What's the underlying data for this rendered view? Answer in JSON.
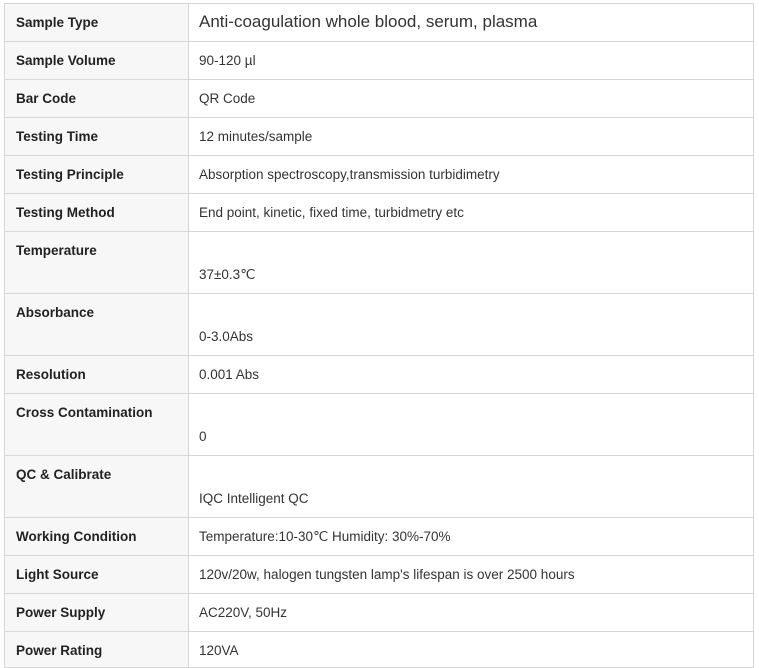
{
  "spec_table": {
    "rows": [
      {
        "label": "Sample Type",
        "value": "Anti-coagulation whole blood, serum, plasma"
      },
      {
        "label": "Sample Volume",
        "value": "90-120 µl"
      },
      {
        "label": "Bar Code",
        "value": "QR Code"
      },
      {
        "label": "Testing Time",
        "value": "12 minutes/sample"
      },
      {
        "label": "Testing Principle",
        "value": "Absorption spectroscopy,transmission turbidimetry"
      },
      {
        "label": "Testing Method",
        "value": "End point, kinetic, fixed time, turbidmetry etc"
      },
      {
        "label": "Temperature",
        "value": "37±0.3℃"
      },
      {
        "label": "Absorbance",
        "value": "0-3.0Abs"
      },
      {
        "label": "Resolution",
        "value": "0.001 Abs"
      },
      {
        "label": "Cross Contamination",
        "value": "0"
      },
      {
        "label": "QC & Calibrate",
        "value": "IQC Intelligent QC"
      },
      {
        "label": "Working Condition",
        "value": "Temperature:10-30℃ Humidity: 30%-70%"
      },
      {
        "label": "Light Source",
        "value": "120v/20w, halogen tungsten lamp's lifespan is over 2500 hours"
      },
      {
        "label": "Power Supply",
        "value": "AC220V, 50Hz"
      },
      {
        "label": "Power Rating",
        "value": "120VA"
      }
    ]
  }
}
